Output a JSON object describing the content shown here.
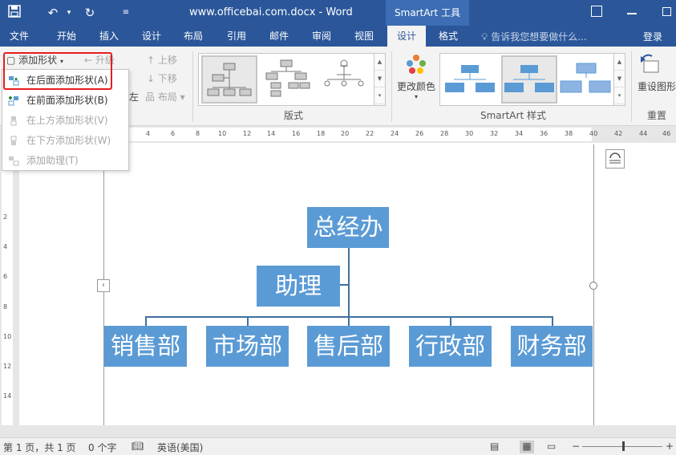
{
  "window": {
    "title": "www.officebai.com.docx - Word",
    "context_tab": "SmartArt 工具"
  },
  "tabs": [
    {
      "label": "文件"
    },
    {
      "label": "开始"
    },
    {
      "label": "插入"
    },
    {
      "label": "设计"
    },
    {
      "label": "布局"
    },
    {
      "label": "引用"
    },
    {
      "label": "邮件"
    },
    {
      "label": "审阅"
    },
    {
      "label": "视图"
    },
    {
      "label": "设计"
    },
    {
      "label": "格式"
    }
  ],
  "tell_me": "告诉我您想要做什么...",
  "signin": "登录",
  "ribbon": {
    "add_shape": "添加形状",
    "promote": "升级",
    "move_up": "上移",
    "move_down": "下移",
    "left_label": "左",
    "layout": "布局",
    "layouts_group": "版式",
    "change_colors": "更改颜色",
    "styles_group": "SmartArt 样式",
    "reset_graphic": "重设图形",
    "reset_group": "重置"
  },
  "dropdown": {
    "items": [
      {
        "label": "在后面添加形状(A)"
      },
      {
        "label": "在前面添加形状(B)"
      },
      {
        "label": "在上方添加形状(V)"
      },
      {
        "label": "在下方添加形状(W)"
      },
      {
        "label": "添加助理(T)"
      }
    ]
  },
  "ruler": {
    "h_ticks": [
      "4",
      "6",
      "8",
      "10",
      "12",
      "14",
      "16",
      "18",
      "20",
      "22",
      "24",
      "26",
      "28",
      "30",
      "32",
      "34",
      "36",
      "38",
      "40",
      "42",
      "44",
      "46"
    ],
    "v_ticks": [
      "2",
      "4",
      "6",
      "8",
      "10",
      "12",
      "14"
    ]
  },
  "smartart": {
    "top": "总经办",
    "assistant": "助理",
    "departments": [
      "销售部",
      "市场部",
      "售后部",
      "行政部",
      "财务部"
    ]
  },
  "status": {
    "page": "第 1 页，共 1 页",
    "words": "0 个字",
    "language": "英语(美国)"
  }
}
